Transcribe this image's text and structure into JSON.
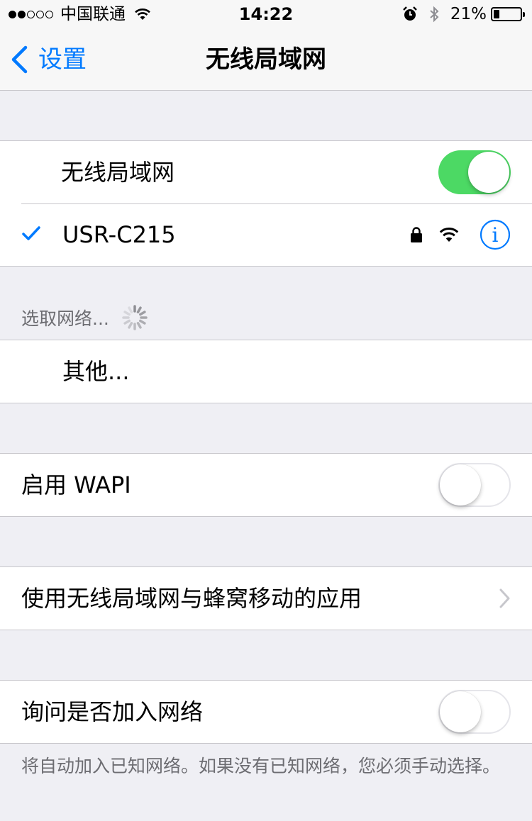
{
  "status_bar": {
    "signal_bars_filled": 2,
    "signal_bars_total": 5,
    "carrier": "中国联通",
    "time": "14:22",
    "battery_percent": "21%"
  },
  "nav": {
    "back_label": "设置",
    "title": "无线局域网"
  },
  "wlan": {
    "toggle_label": "无线局域网",
    "toggle_on": true,
    "connected_network": "USR-C215"
  },
  "choose_network": {
    "header": "选取网络...",
    "other_label": "其他..."
  },
  "wapi": {
    "label": "启用 WAPI",
    "toggle_on": false
  },
  "apps": {
    "label": "使用无线局域网与蜂窝移动的应用"
  },
  "ask_join": {
    "label": "询问是否加入网络",
    "toggle_on": false,
    "footer": "将自动加入已知网络。如果没有已知网络，您必须手动选择。"
  },
  "colors": {
    "accent": "#007aff",
    "toggle_on": "#4cd964",
    "background": "#efeff4"
  }
}
